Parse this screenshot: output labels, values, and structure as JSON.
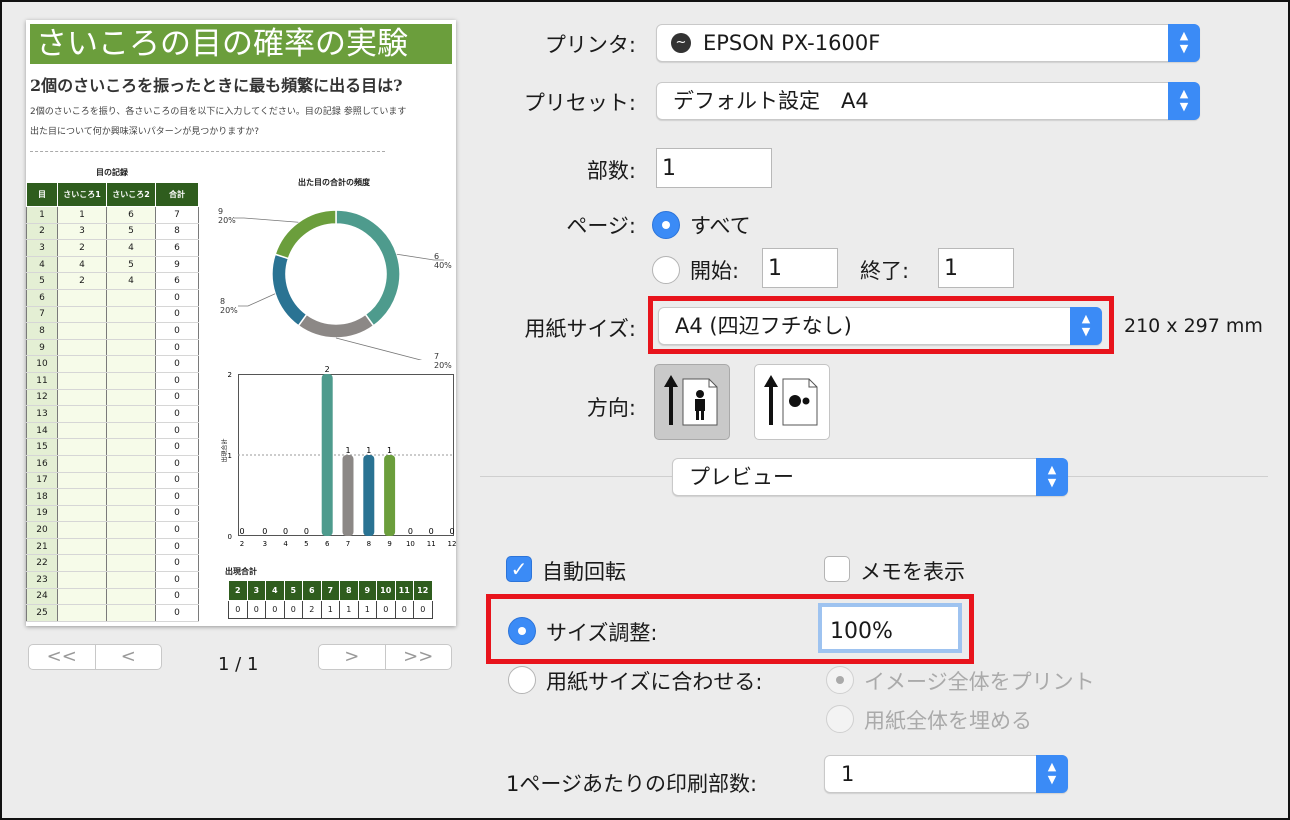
{
  "preview": {
    "title": "さいころの目の確率の実験",
    "question": "2個のさいころを振ったときに最も頻繁に出る目は?",
    "desc1": "2個のさいころを振り、各さいころの目を以下に入力してください。目の記録 参照しています",
    "desc2": "出た目について何か興味深いパターンが見つかりますか?",
    "table_title": "目の記録",
    "table_headers": [
      "目",
      "さいころ1",
      "さいころ2",
      "合計"
    ],
    "table_rows": [
      [
        "1",
        "1",
        "6",
        "7"
      ],
      [
        "2",
        "3",
        "5",
        "8"
      ],
      [
        "3",
        "2",
        "4",
        "6"
      ],
      [
        "4",
        "4",
        "5",
        "9"
      ],
      [
        "5",
        "2",
        "4",
        "6"
      ],
      [
        "6",
        "",
        "",
        "0"
      ],
      [
        "7",
        "",
        "",
        "0"
      ],
      [
        "8",
        "",
        "",
        "0"
      ],
      [
        "9",
        "",
        "",
        "0"
      ],
      [
        "10",
        "",
        "",
        "0"
      ],
      [
        "11",
        "",
        "",
        "0"
      ],
      [
        "12",
        "",
        "",
        "0"
      ],
      [
        "13",
        "",
        "",
        "0"
      ],
      [
        "14",
        "",
        "",
        "0"
      ],
      [
        "15",
        "",
        "",
        "0"
      ],
      [
        "16",
        "",
        "",
        "0"
      ],
      [
        "17",
        "",
        "",
        "0"
      ],
      [
        "18",
        "",
        "",
        "0"
      ],
      [
        "19",
        "",
        "",
        "0"
      ],
      [
        "20",
        "",
        "",
        "0"
      ],
      [
        "21",
        "",
        "",
        "0"
      ],
      [
        "22",
        "",
        "",
        "0"
      ],
      [
        "23",
        "",
        "",
        "0"
      ],
      [
        "24",
        "",
        "",
        "0"
      ],
      [
        "25",
        "",
        "",
        "0"
      ]
    ],
    "sum_table_headers": [
      "2",
      "3",
      "4",
      "5",
      "6",
      "7",
      "8",
      "9",
      "10",
      "11",
      "12"
    ],
    "sum_table_values": [
      "0",
      "0",
      "0",
      "0",
      "2",
      "1",
      "1",
      "1",
      "0",
      "0",
      "0"
    ]
  },
  "chart_data": [
    {
      "type": "pie",
      "title": "出た目の合計の頻度",
      "slices": [
        {
          "label": "6",
          "value": 40,
          "pct": "40%",
          "color": "#4e9b8d"
        },
        {
          "label": "7",
          "value": 20,
          "pct": "20%",
          "color": "#8c8886"
        },
        {
          "label": "8",
          "value": 20,
          "pct": "20%",
          "color": "#2a7393"
        },
        {
          "label": "9",
          "value": 20,
          "pct": "20%",
          "color": "#6b9e3c"
        }
      ]
    },
    {
      "type": "bar",
      "title": "",
      "categories": [
        "2",
        "3",
        "4",
        "5",
        "6",
        "7",
        "8",
        "9",
        "10",
        "11",
        "12"
      ],
      "values": [
        0,
        0,
        0,
        0,
        2,
        1,
        1,
        1,
        0,
        0,
        0
      ],
      "colors": [
        "#4e9b8d",
        "#4e9b8d",
        "#4e9b8d",
        "#4e9b8d",
        "#4e9b8d",
        "#8c8886",
        "#2a7393",
        "#6b9e3c",
        "#4e9b8d",
        "#4e9b8d",
        "#4e9b8d"
      ],
      "xlabel": "出現合計",
      "ylabel": "出現合計",
      "ylim": [
        0,
        2
      ],
      "yticks": [
        "0",
        "1",
        "2"
      ],
      "grid": true
    }
  ],
  "nav": {
    "first": "<<",
    "prev": "<",
    "next": ">",
    "last": ">>",
    "page_indicator": "1 / 1"
  },
  "settings": {
    "printer_label": "プリンタ:",
    "printer_value": "EPSON PX-1600F",
    "preset_label": "プリセット:",
    "preset_value": "デフォルト設定　A4",
    "copies_label": "部数:",
    "copies_value": "1",
    "pages_label": "ページ:",
    "pages_all": "すべて",
    "pages_from": "開始:",
    "from_value": "1",
    "pages_to": "終了:",
    "to_value": "1",
    "paper_label": "用紙サイズ:",
    "paper_value": "A4 (四辺フチなし)",
    "paper_dims": "210 x 297 mm",
    "orientation_label": "方向:",
    "section_value": "プレビュー",
    "auto_rotate": "自動回転",
    "show_notes": "メモを表示",
    "scale_label": "サイズ調整:",
    "scale_value": "100%",
    "fit_label": "用紙サイズに合わせる:",
    "fit_print_entire": "イメージ全体をプリント",
    "fit_fill_paper": "用紙全体を埋める",
    "pages_per_sheet_label": "1ページあたりの印刷部数:",
    "pages_per_sheet_value": "1"
  },
  "colors": {
    "accent": "#3b8bf6",
    "highlight": "#e8141c",
    "title_green": "#6b9e3c",
    "header_green": "#2f5d1e"
  }
}
